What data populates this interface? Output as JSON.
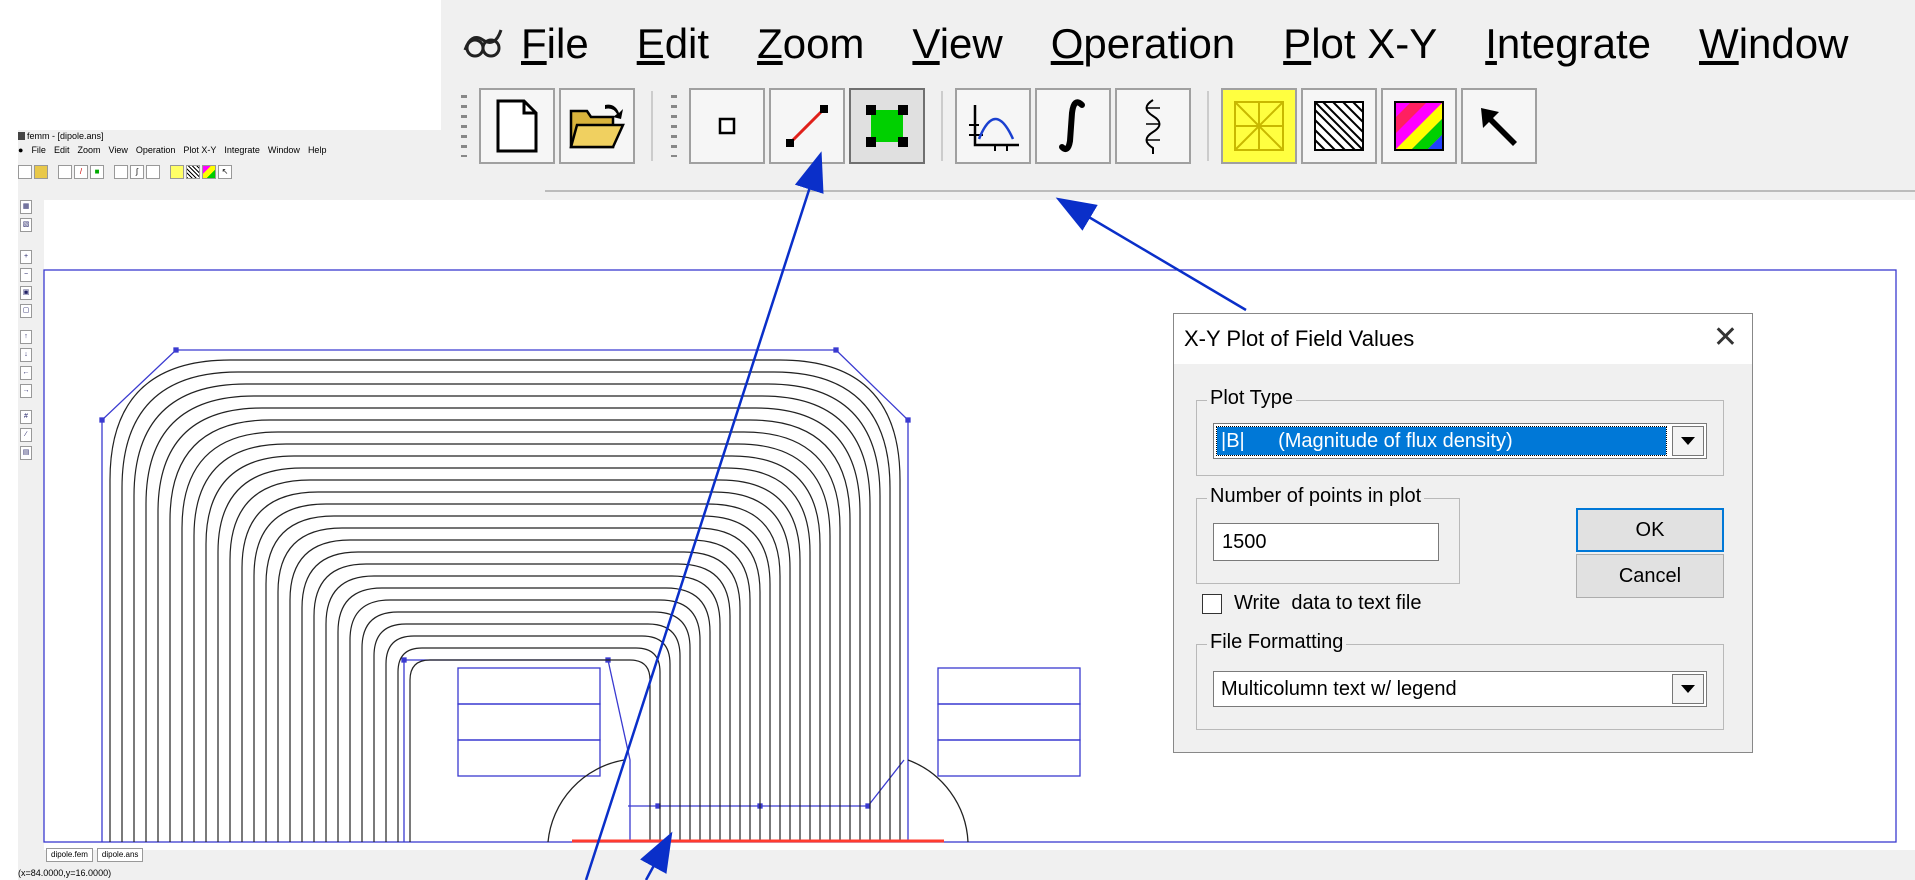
{
  "small_window": {
    "title": "femm - [dipole.ans]",
    "menu": [
      "File",
      "Edit",
      "Zoom",
      "View",
      "Operation",
      "Plot X-Y",
      "Integrate",
      "Window",
      "Help"
    ],
    "doc_tabs": [
      "dipole.fem",
      "dipole.ans"
    ],
    "status": "(x=84.0000,y=16.0000)"
  },
  "big_menu": [
    "File",
    "Edit",
    "Zoom",
    "View",
    "Operation",
    "Plot X-Y",
    "Integrate",
    "Window"
  ],
  "toolbar_icons": [
    "new-file-icon",
    "open-folder-icon",
    "point-mode-icon",
    "contour-line-icon",
    "area-block-icon",
    "xy-plot-icon",
    "integral-icon",
    "fieldline-icon",
    "yellow-grid-icon",
    "hatch-icon",
    "color-density-icon",
    "select-arrow-icon"
  ],
  "dialog": {
    "title": "X-Y Plot of Field Values",
    "plot_type_label": "Plot Type",
    "plot_type_value": "|B|      (Magnitude of flux density)",
    "points_label": "Number of points in plot",
    "points_value": "1500",
    "ok_label": "OK",
    "cancel_label": "Cancel",
    "write_label": "Write  data to text file",
    "write_checked": false,
    "format_label": "File Formatting",
    "format_value": "Multicolumn text w/ legend"
  },
  "colors": {
    "geometry": "#3a3ad0",
    "flux_line": "#222222",
    "annotation_arrow": "#0a2fc9",
    "selection_blue": "#0078d7",
    "contour_red": "#ff3b2f"
  }
}
